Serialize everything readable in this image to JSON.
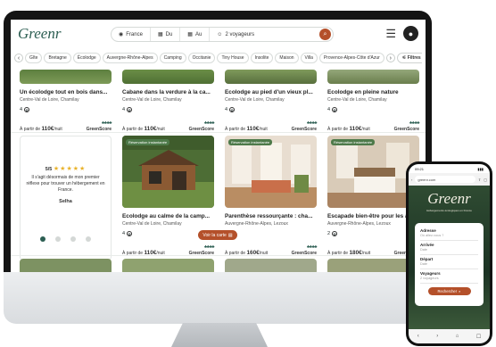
{
  "app": {
    "logo": "Greenr"
  },
  "search": {
    "destination": "France",
    "arrival": "Du",
    "departure": "Au",
    "guests": "2 voyageurs"
  },
  "categories": [
    "Gîte",
    "Bretagne",
    "Écolodge",
    "Auvergne-Rhône-Alpes",
    "Camping",
    "Occitanie",
    "Tiny House",
    "Insolite",
    "Maison",
    "Villa",
    "Provence-Alpes-Côte d'Azur"
  ],
  "filters_label": "Filtres",
  "top_cards": [
    {
      "title": "Un écolodge tout en bois dans...",
      "location": "Centre-Val de Loire, Chamilay",
      "score": "4",
      "price_prefix": "À partir de",
      "price": "110€",
      "unit": "/nuit",
      "greenscore": "GreenScore"
    },
    {
      "title": "Cabane dans la verdure à la ca...",
      "location": "Centre-Val de Loire, Chamilay",
      "score": "4",
      "price_prefix": "À partir de",
      "price": "110€",
      "unit": "/nuit",
      "greenscore": "GreenScore"
    },
    {
      "title": "Ecolodge au pied d'un vieux pl...",
      "location": "Centre-Val de Loire, Chamilay",
      "score": "4",
      "price_prefix": "À partir de",
      "price": "110€",
      "unit": "/nuit",
      "greenscore": "GreenScore"
    },
    {
      "title": "Ecolodge en pleine nature",
      "location": "Centre-Val de Loire, Chamilay",
      "score": "4",
      "price_prefix": "À partir de",
      "price": "110€",
      "unit": "/nuit",
      "greenscore": "GreenScore"
    }
  ],
  "review": {
    "score": "5/5",
    "stars": "★★★★★",
    "text": "Il s'agit désormais de mon premier réflexe pour trouver un hébergement en France.",
    "author": "Selha"
  },
  "bottom_cards": [
    {
      "badge": "Réservation instantanée",
      "title": "Ecolodge au calme de la camp...",
      "location": "Centre-Val de Loire, Chamilay",
      "score": "4",
      "price_prefix": "À partir de",
      "price": "110€",
      "unit": "/nuit",
      "greenscore": "GreenScore"
    },
    {
      "badge": "Réservation instantanée",
      "title": "Parenthèse ressourçante : cha...",
      "location": "Auvergne-Rhône-Alpes, Lezoux",
      "score": "4",
      "price_prefix": "À partir de",
      "price": "160€",
      "unit": "/nuit",
      "greenscore": "GreenScore"
    },
    {
      "badge": "Réservation instantanée",
      "title": "Escapade bien-être pour les a...",
      "location": "Auvergne-Rhône-Alpes, Lezoux",
      "score": "2",
      "price_prefix": "À partir de",
      "price": "180€",
      "unit": "/nuit",
      "greenscore": "GreenScore"
    }
  ],
  "map_button": "Voir la carte",
  "phone": {
    "time": "09:21",
    "url": "greenr.com",
    "logo": "Greenr",
    "tagline": "Hébergements écologiques en France",
    "fields": [
      {
        "label": "Adresse",
        "placeholder": "Où allez-vous ?"
      },
      {
        "label": "Arrivée",
        "placeholder": "Date"
      },
      {
        "label": "Départ",
        "placeholder": "Date"
      },
      {
        "label": "Voyageurs",
        "placeholder": "2 voyageurs"
      }
    ],
    "button": "Rechercher"
  },
  "colors": {
    "brand": "#2c5e52",
    "accent": "#b4502a"
  }
}
